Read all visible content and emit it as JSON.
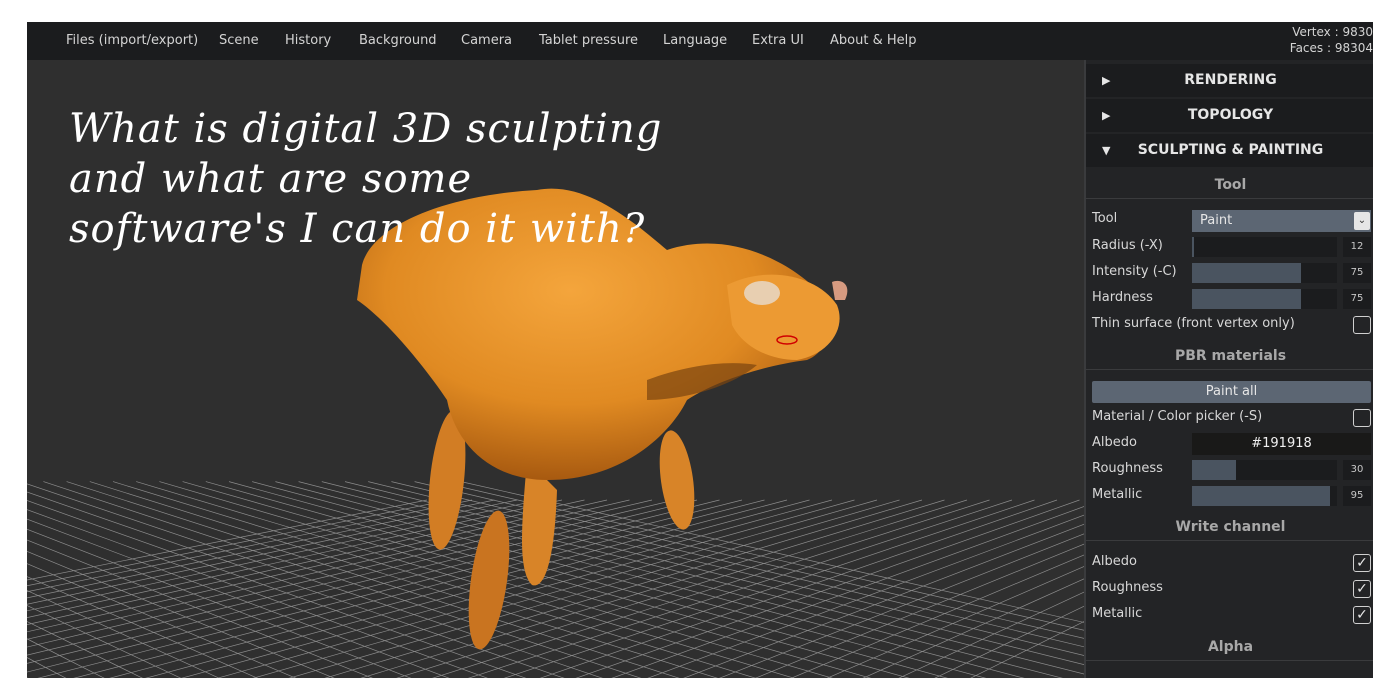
{
  "menu": {
    "items": [
      "Files (import/export)",
      "Scene",
      "History",
      "Background",
      "Camera",
      "Tablet pressure",
      "Language",
      "Extra UI",
      "About & Help"
    ]
  },
  "stats": {
    "vertex": "Vertex : 9830",
    "faces": "Faces : 98304"
  },
  "question": "What is digital 3D sculpting\nand what are some\nsoftware's I can do it with?",
  "panel": {
    "sections": {
      "rendering": {
        "label": "RENDERING",
        "icon": "triangle-right-icon"
      },
      "topology": {
        "label": "TOPOLOGY",
        "icon": "triangle-right-icon"
      },
      "sculpting": {
        "label": "SCULPTING & PAINTING",
        "icon": "triangle-down-icon"
      }
    },
    "tool_group": {
      "title": "Tool",
      "tool_label": "Tool",
      "tool_value": "Paint",
      "radius_label": "Radius (-X)",
      "radius_value": 12,
      "intensity_label": "Intensity (-C)",
      "intensity_value": 75,
      "hardness_label": "Hardness",
      "hardness_value": 75,
      "thin_label": "Thin surface (front vertex only)",
      "thin_checked": false
    },
    "pbr_group": {
      "title": "PBR materials",
      "paint_all": "Paint all",
      "picker_label": "Material / Color picker (-S)",
      "picker_checked": false,
      "albedo_label": "Albedo",
      "albedo_value": "#191918",
      "roughness_label": "Roughness",
      "roughness_value": 30,
      "metallic_label": "Metallic",
      "metallic_value": 95
    },
    "write_group": {
      "title": "Write channel",
      "albedo": "Albedo",
      "albedo_checked": true,
      "roughness": "Roughness",
      "roughness_checked": true,
      "metallic": "Metallic",
      "metallic_checked": true
    },
    "alpha_group": {
      "title": "Alpha"
    }
  },
  "colors": {
    "accent": "#5c6673",
    "slider_fill": "#4a5460",
    "model": "#e8942c",
    "menubar": "#1b1c1e",
    "viewport": "#2f2f2f"
  }
}
